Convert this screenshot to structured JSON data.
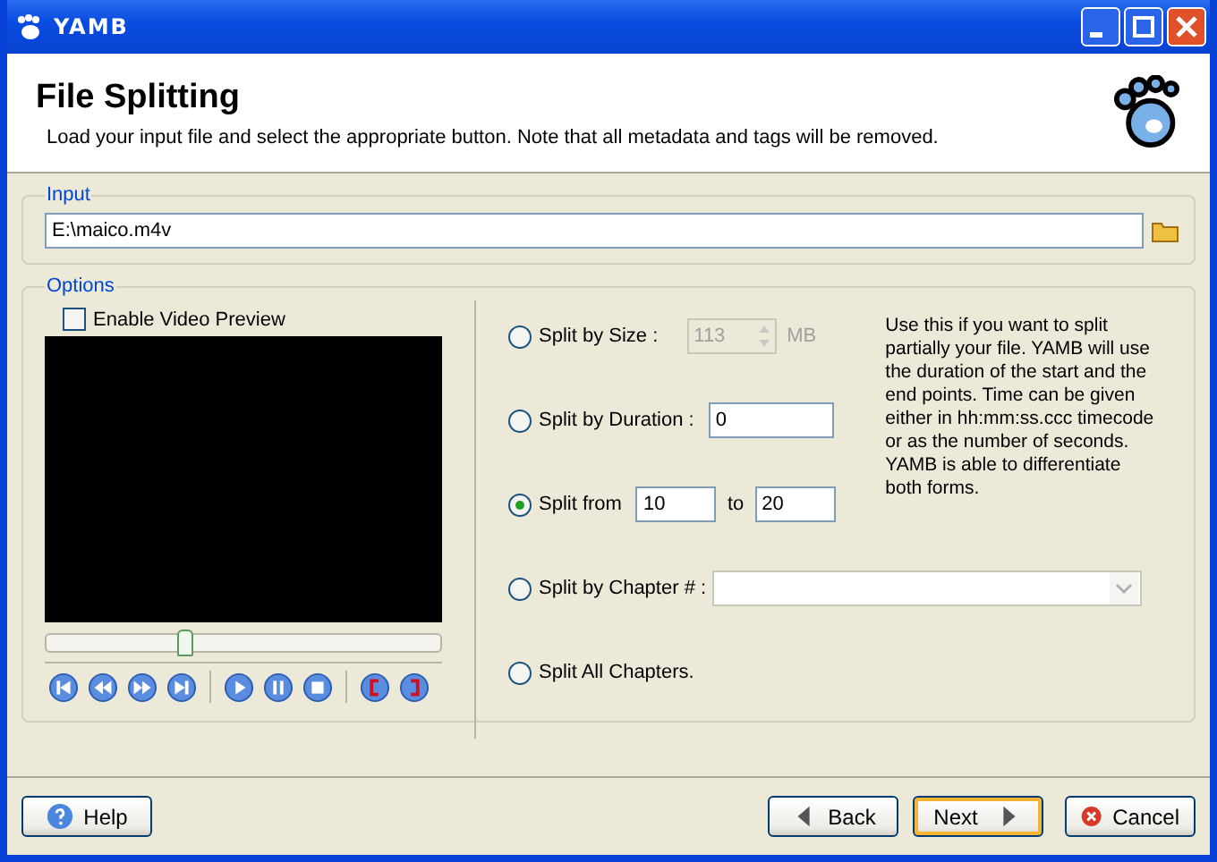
{
  "window": {
    "title": "YAMB"
  },
  "header": {
    "title": "File Splitting",
    "subtitle": "Load your input file and select the appropriate button. Note that all metadata and tags will be removed."
  },
  "input": {
    "legend": "Input",
    "value": "E:\\maico.m4v"
  },
  "options": {
    "legend": "Options",
    "preview": {
      "label": "Enable Video Preview",
      "checked": false
    },
    "seek": {
      "level": 0.35
    },
    "media_buttons": [
      {
        "kind": "first"
      },
      {
        "kind": "rewind"
      },
      {
        "kind": "forward"
      },
      {
        "kind": "last"
      },
      {
        "kind": "sep"
      },
      {
        "kind": "play"
      },
      {
        "kind": "pause"
      },
      {
        "kind": "stop"
      },
      {
        "kind": "sep"
      },
      {
        "kind": "mark-in"
      },
      {
        "kind": "mark-out"
      }
    ],
    "modes": [
      {
        "kind": "size",
        "label": "Split by Size :",
        "selected": false,
        "value": "113",
        "unit": "MB",
        "disabled": true
      },
      {
        "kind": "duration",
        "label": "Split by Duration :",
        "selected": false,
        "value": "0"
      },
      {
        "kind": "range",
        "label": "Split from",
        "selected": true,
        "from": "10",
        "to_label": "to",
        "to": "20"
      },
      {
        "kind": "chapter",
        "label": "Split by Chapter # :",
        "selected": false
      },
      {
        "kind": "all",
        "label": "Split All Chapters.",
        "selected": false
      }
    ],
    "help_text": "Use this if you want to split partially your file. YAMB will use the duration of the start and the end points. Time can be given either in hh:mm:ss.ccc timecode or as the number of seconds. YAMB is able to differentiate both forms."
  },
  "buttons": [
    {
      "kind": "help",
      "label": "Help"
    },
    {
      "kind": "back",
      "label": "Back"
    },
    {
      "kind": "next",
      "label": "Next",
      "focused": true
    },
    {
      "kind": "cancel",
      "label": "Cancel"
    }
  ]
}
